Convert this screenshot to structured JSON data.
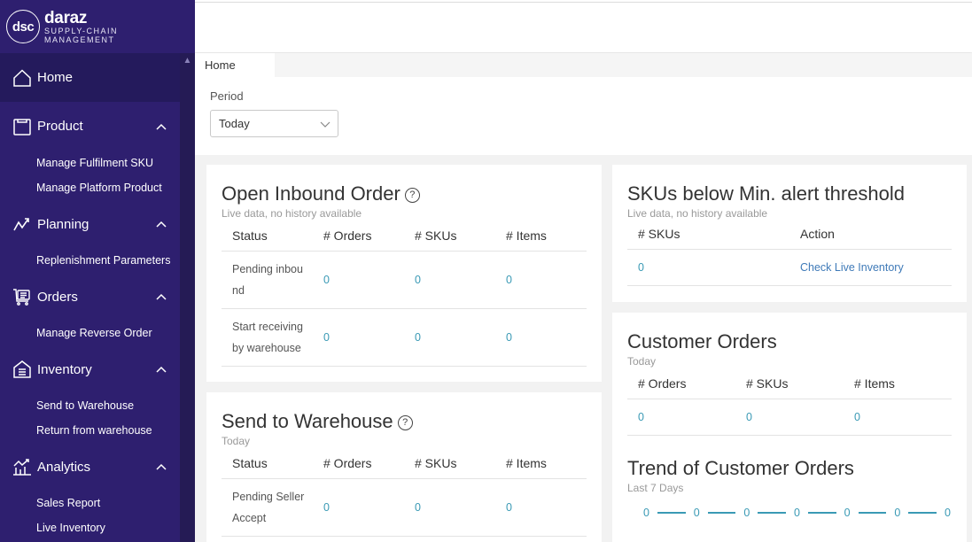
{
  "brand": {
    "logo_mark": "dsc",
    "name": "daraz",
    "subtitle_line1": "SUPPLY-CHAIN",
    "subtitle_line2": "MANAGEMENT"
  },
  "sidebar": {
    "home": {
      "label": "Home",
      "icon": "home-icon",
      "active": true
    },
    "groups": [
      {
        "label": "Product",
        "icon": "product-icon",
        "expanded": true,
        "items": [
          "Manage Fulfilment SKU",
          "Manage Platform Product"
        ]
      },
      {
        "label": "Planning",
        "icon": "planning-icon",
        "expanded": true,
        "items": [
          "Replenishment Parameters"
        ]
      },
      {
        "label": "Orders",
        "icon": "orders-cart-icon",
        "expanded": true,
        "items": [
          "Manage Reverse Order"
        ]
      },
      {
        "label": "Inventory",
        "icon": "inventory-icon",
        "expanded": true,
        "items": [
          "Send to Warehouse",
          "Return from warehouse"
        ]
      },
      {
        "label": "Analytics",
        "icon": "analytics-icon",
        "expanded": true,
        "items": [
          "Sales Report",
          "Live Inventory"
        ]
      }
    ]
  },
  "tabs": [
    {
      "label": "Home",
      "active": true
    }
  ],
  "filter": {
    "period_label": "Period",
    "period_value": "Today"
  },
  "open_inbound": {
    "title": "Open Inbound Order",
    "subtitle": "Live data, no history available",
    "columns": [
      "Status",
      "# Orders",
      "# SKUs",
      "# Items"
    ],
    "rows": [
      {
        "status_line1": "Pending inbou",
        "status_line2": "nd",
        "orders": "0",
        "skus": "0",
        "items": "0"
      },
      {
        "status_line1": "Start receiving",
        "status_line2": "by warehouse",
        "orders": "0",
        "skus": "0",
        "items": "0"
      }
    ]
  },
  "send_to_warehouse": {
    "title": "Send to Warehouse",
    "subtitle": "Today",
    "columns": [
      "Status",
      "# Orders",
      "# SKUs",
      "# Items"
    ],
    "rows": [
      {
        "status_line1": "Pending Seller",
        "status_line2": "Accept",
        "orders": "0",
        "skus": "0",
        "items": "0"
      }
    ]
  },
  "skus_below": {
    "title": "SKUs below Min. alert threshold",
    "subtitle": "Live data, no history available",
    "columns": [
      "# SKUs",
      "Action"
    ],
    "rows": [
      {
        "skus": "0",
        "action": "Check Live Inventory"
      }
    ]
  },
  "customer_orders": {
    "title": "Customer Orders",
    "subtitle": "Today",
    "columns": [
      "# Orders",
      "# SKUs",
      "# Items"
    ],
    "rows": [
      {
        "orders": "0",
        "skus": "0",
        "items": "0"
      }
    ]
  },
  "trend": {
    "title": "Trend of Customer Orders",
    "subtitle": "Last 7 Days",
    "values": [
      "0",
      "0",
      "0",
      "0",
      "0",
      "0",
      "0"
    ]
  },
  "colors": {
    "sidebar_bg": "#2e1f6f",
    "sidebar_active": "#241a5c",
    "link_value": "#3a9ab5",
    "action_link": "#3f7ab8"
  }
}
